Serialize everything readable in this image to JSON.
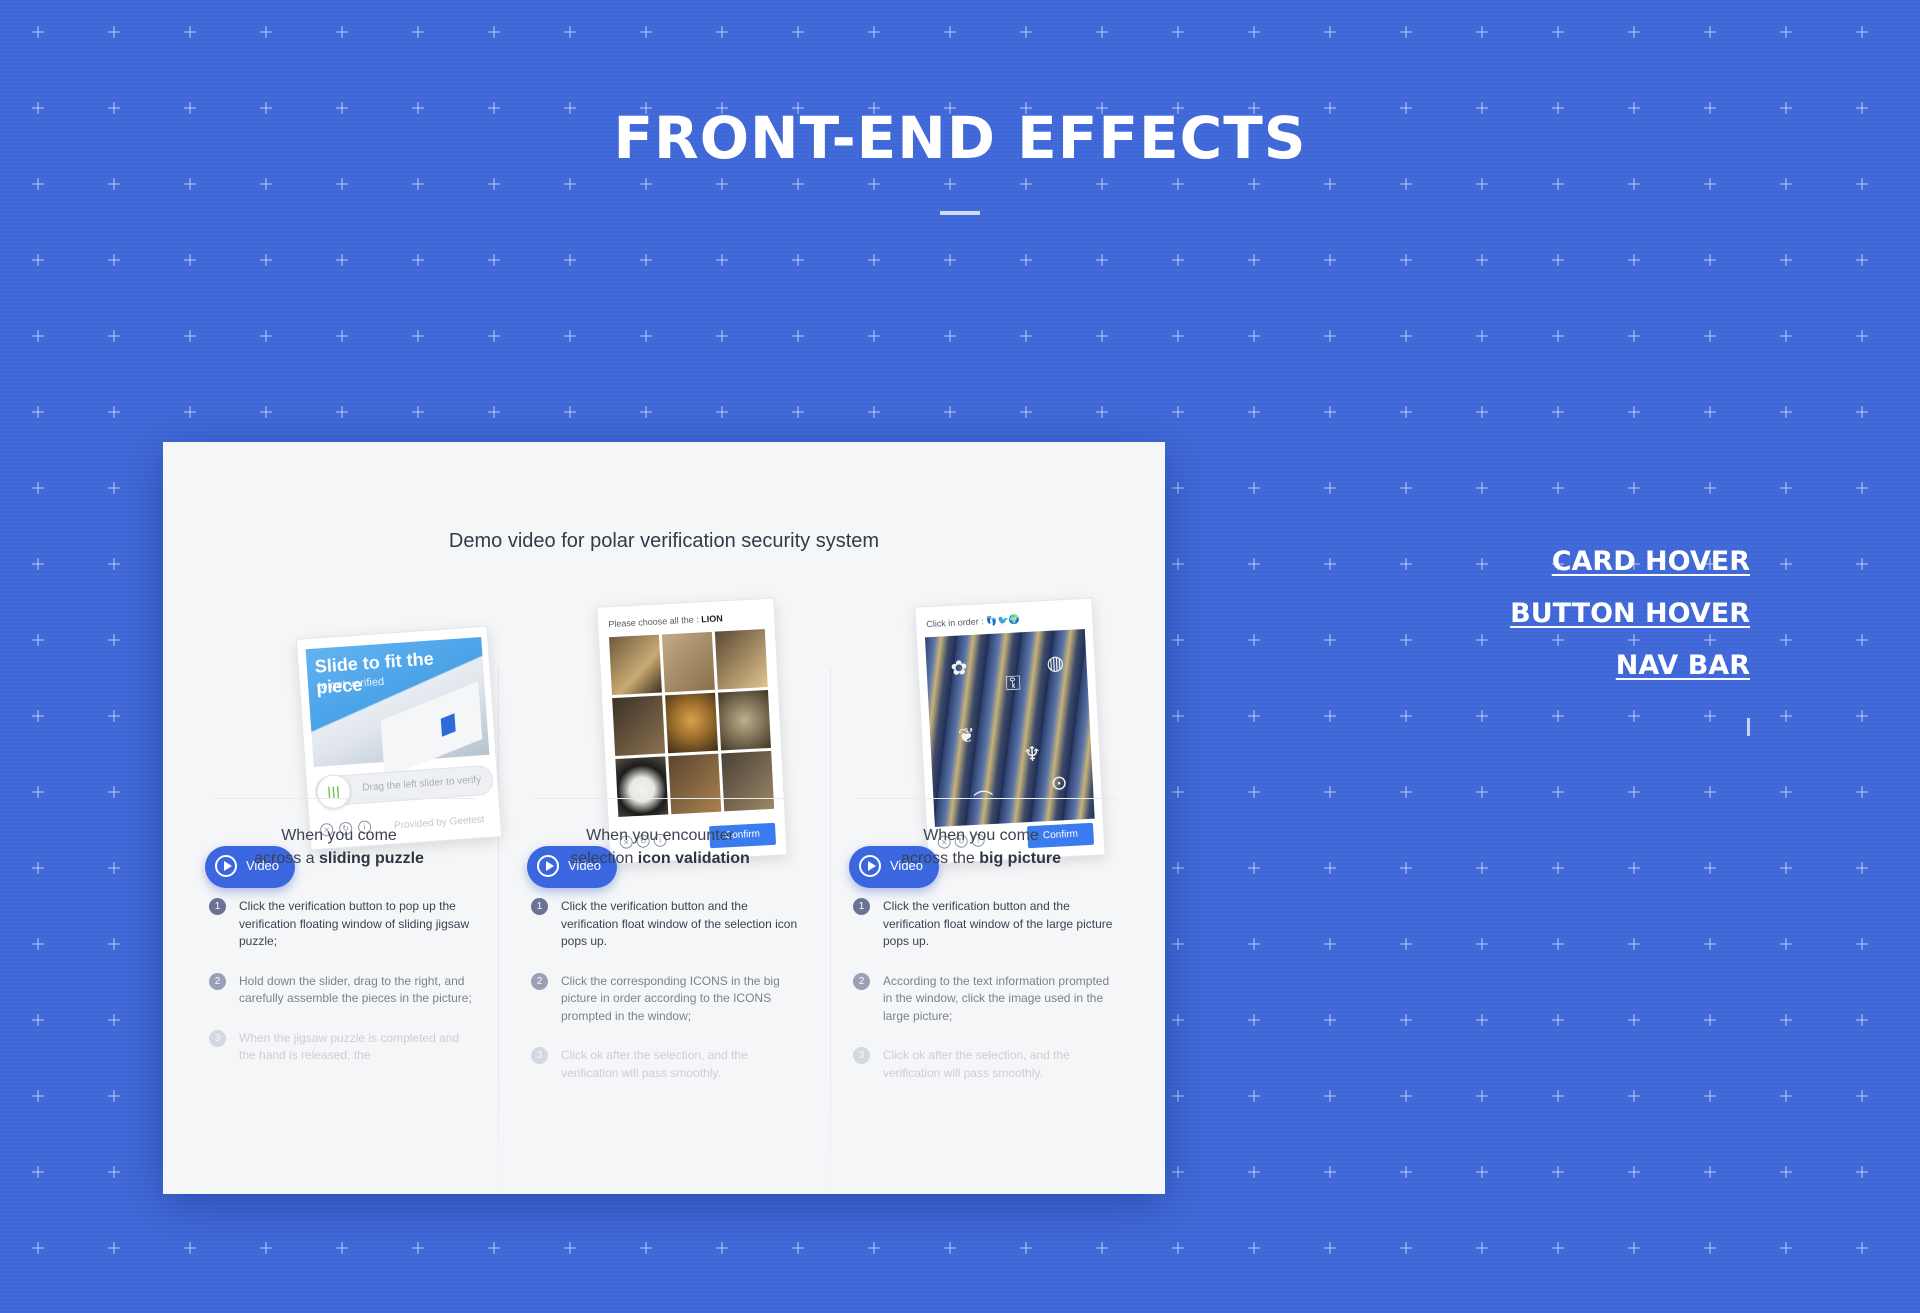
{
  "page": {
    "title": "FRONT-END EFFECTS",
    "background_color": "#3d66d6"
  },
  "demo": {
    "heading": "Demo video for polar verification security system",
    "video_label": "Video",
    "columns": [
      {
        "widget": {
          "headline": "Slide to fit the piece",
          "subline": "to get verified",
          "slider_text": "Drag the left slider to verify",
          "provided_text": "Provided by Geetest"
        },
        "title_prefix": "When you come",
        "title_line2_prefix": "across a ",
        "title_bold": "sliding puzzle",
        "steps": [
          {
            "num": "1",
            "text": "Click the verification button to pop up the verification floating window of sliding jigsaw puzzle;"
          },
          {
            "num": "2",
            "text": "Hold down the slider, drag to the right, and carefully assemble the pieces in the picture;"
          },
          {
            "num": "3",
            "text": "When the jigsaw puzzle is completed and the hand is released, the"
          }
        ]
      },
      {
        "widget": {
          "prompt": "Please choose all the :",
          "prompt_target": "LION",
          "confirm": "Confirm"
        },
        "title_prefix": "When you encounter",
        "title_line2_prefix": "selection ",
        "title_bold": "icon validation",
        "steps": [
          {
            "num": "1",
            "text": "Click the verification button and the verification float window of the selection icon pops up."
          },
          {
            "num": "2",
            "text": "Click the corresponding ICONS in the big picture in order according to the ICONS prompted in the window;"
          },
          {
            "num": "3",
            "text": "Click ok after the selection, and the verification will pass smoothly."
          }
        ]
      },
      {
        "widget": {
          "prompt": "Click in order :",
          "confirm": "Confirm"
        },
        "title_prefix": "When you come",
        "title_line2_prefix": "across the ",
        "title_bold": "big picture",
        "steps": [
          {
            "num": "1",
            "text": "Click the verification button and the verification float window of the large picture pops up."
          },
          {
            "num": "2",
            "text": "According to the text information prompted in the window, click the image used in the large picture;"
          },
          {
            "num": "3",
            "text": "Click ok after the selection, and the verification will pass smoothly."
          }
        ]
      }
    ]
  },
  "nav": {
    "items": [
      {
        "label": "CARD HOVER"
      },
      {
        "label": "BUTTON HOVER"
      },
      {
        "label": "NAV BAR"
      }
    ]
  }
}
